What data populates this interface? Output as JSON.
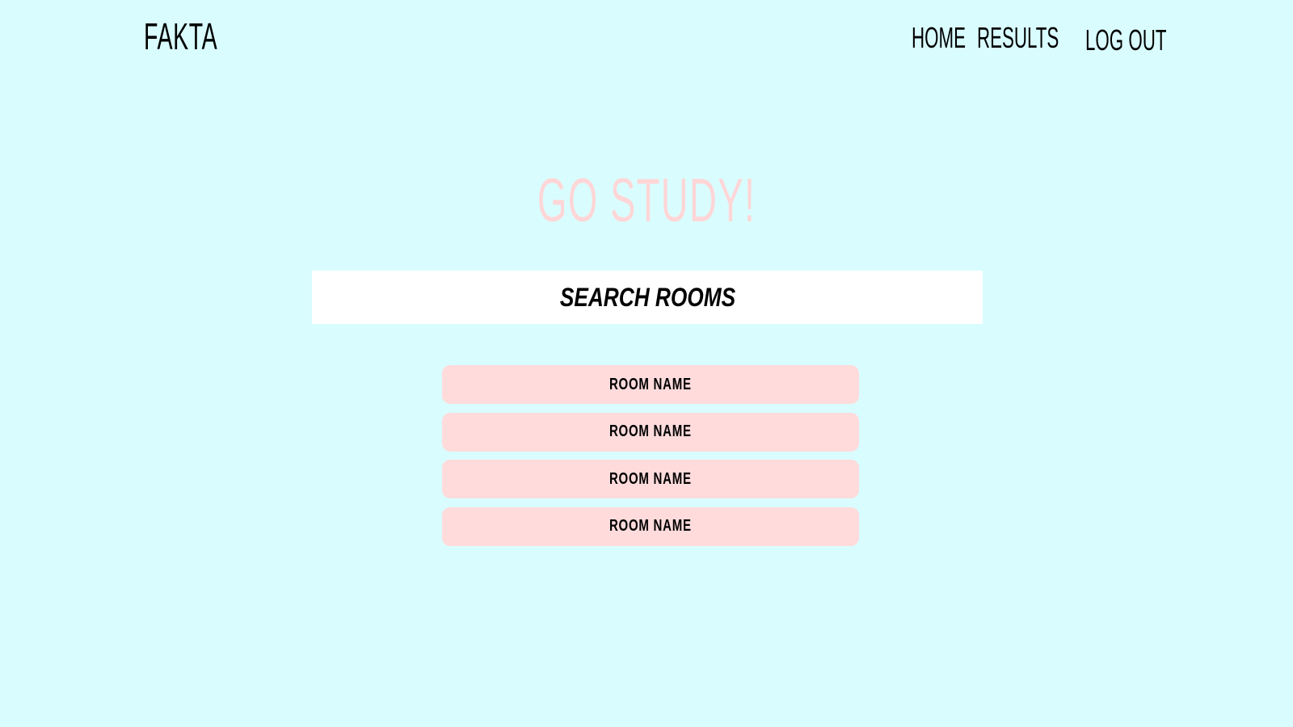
{
  "header": {
    "logo": "FAKTA",
    "nav": {
      "home": "HOME",
      "results": "RESULTS",
      "logout": "LOG OUT"
    }
  },
  "main": {
    "headline": "GO STUDY!",
    "search_label": "SEARCH ROOMS",
    "rooms": [
      {
        "label": "ROOM NAME"
      },
      {
        "label": "ROOM NAME"
      },
      {
        "label": "ROOM NAME"
      },
      {
        "label": "ROOM NAME"
      }
    ]
  },
  "colors": {
    "background": "#d9fdff",
    "headline": "#ffd6d7",
    "room_button": "#ffdbdc",
    "search_bar": "#ffffff",
    "text": "#000000"
  }
}
